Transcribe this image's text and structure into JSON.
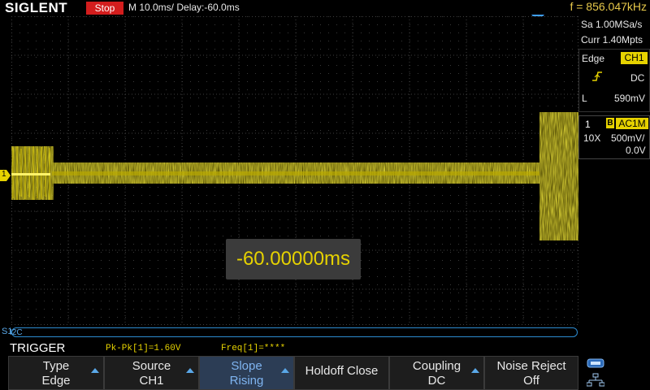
{
  "top": {
    "logo": "SIGLENT",
    "run_state": "Stop",
    "timebase": "M 10.0ms/ Delay:-60.0ms",
    "frequency": "f = 856.047kHz"
  },
  "acquisition": {
    "sample_rate": "Sa 1.00MSa/s",
    "memory": "Curr 1.40Mpts"
  },
  "trigger_info": {
    "type": "Edge",
    "source": "CH1",
    "coupling": "DC",
    "level_label": "L",
    "level": "590mV"
  },
  "channel_info": {
    "number": "1",
    "bw_flag": "B",
    "coupling": "AC1M",
    "probe": "10X",
    "scale": "500mV/",
    "offset": "0.0V"
  },
  "waveform": {
    "channel_marker": "1",
    "delay_readout": "-60.00000ms",
    "decode_label": "S1",
    "decode_protocol": "I2C"
  },
  "measurements": {
    "menu_title": "TRIGGER",
    "pkpk": "Pk-Pk[1]=1.60V",
    "freq": "Freq[1]=****"
  },
  "softkeys": [
    {
      "line1": "Type",
      "line2": "Edge"
    },
    {
      "line1": "Source",
      "line2": "CH1"
    },
    {
      "line1": "Slope",
      "line2": "Rising"
    },
    {
      "line1": "Holdoff Close",
      "line2": ""
    },
    {
      "line1": "Coupling",
      "line2": "DC"
    },
    {
      "line1": "Noise Reject",
      "line2": "Off"
    }
  ],
  "colors": {
    "trace": "#e6d200",
    "accent_blue": "#5aa8e8",
    "stop_red": "#d31d1d"
  }
}
